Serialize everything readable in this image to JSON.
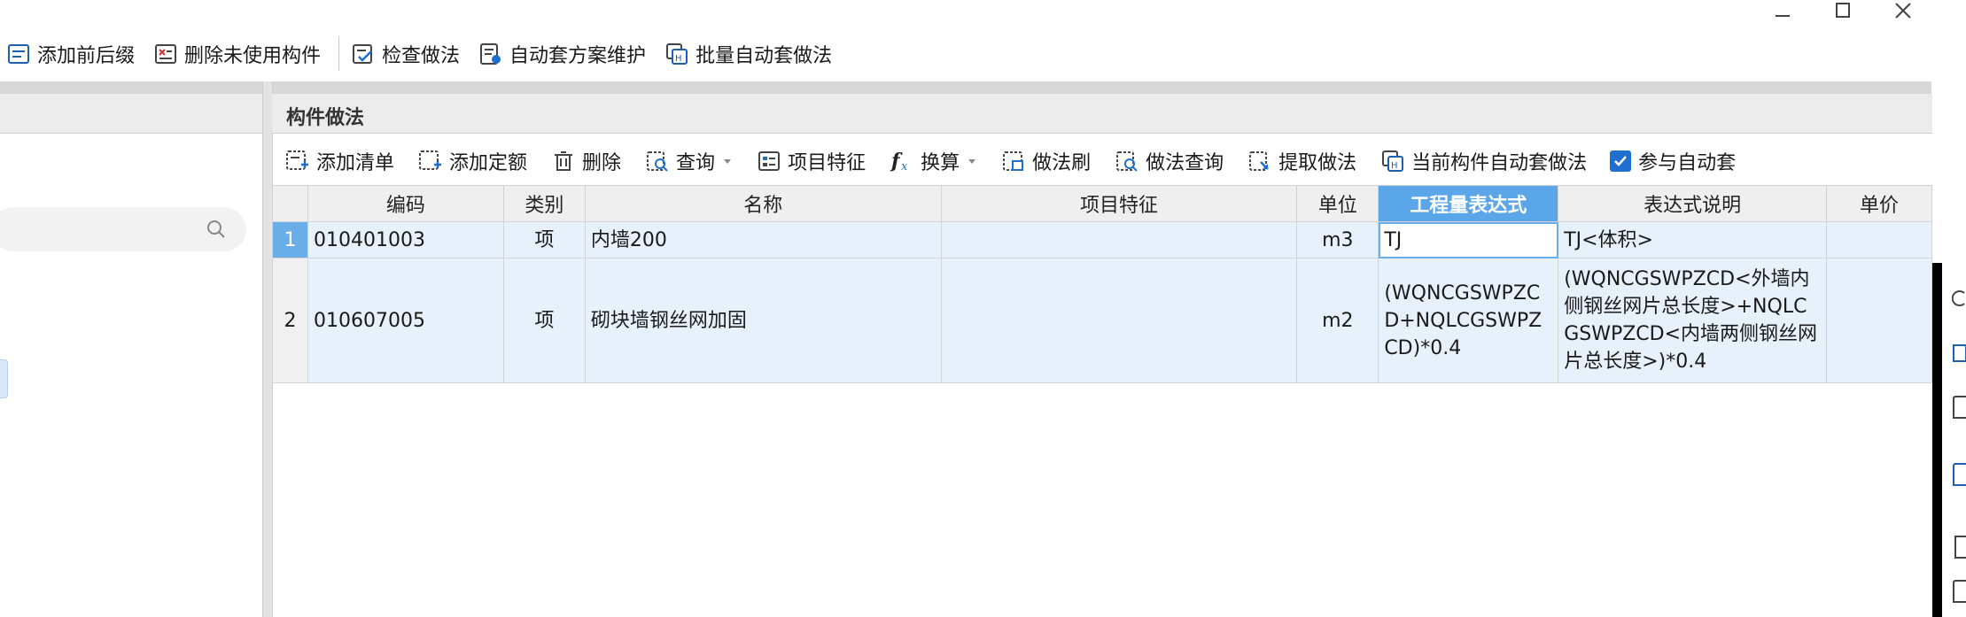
{
  "window": {
    "minimize_icon": "minimize-icon",
    "maximize_icon": "maximize-icon",
    "close_icon": "close-icon"
  },
  "toolbar_top": {
    "items": [
      {
        "label": "添加前后缀",
        "icon": "add-prefix-icon"
      },
      {
        "label": "删除未使用构件",
        "icon": "delete-unused-icon"
      },
      {
        "label": "检查做法",
        "icon": "check-method-icon"
      },
      {
        "label": "自动套方案维护",
        "icon": "auto-scheme-icon"
      },
      {
        "label": "批量自动套做法",
        "icon": "batch-auto-icon"
      }
    ]
  },
  "panel": {
    "title": "构件做法"
  },
  "toolbar2": {
    "items": [
      {
        "label": "添加清单",
        "icon": "add-list-icon"
      },
      {
        "label": "添加定额",
        "icon": "add-quota-icon"
      },
      {
        "label": "删除",
        "icon": "trash-icon"
      },
      {
        "label": "查询",
        "icon": "query-icon"
      },
      {
        "label": "项目特征",
        "icon": "feature-icon"
      },
      {
        "label": "换算",
        "icon": "fx-icon"
      },
      {
        "label": "做法刷",
        "icon": "brush-icon"
      },
      {
        "label": "做法查询",
        "icon": "method-query-icon"
      },
      {
        "label": "提取做法",
        "icon": "extract-icon"
      },
      {
        "label": "当前构件自动套做法",
        "icon": "current-auto-icon"
      }
    ],
    "checkbox_label": "参与自动套",
    "checkbox_checked": true
  },
  "table": {
    "columns": [
      "编码",
      "类别",
      "名称",
      "项目特征",
      "单位",
      "工程量表达式",
      "表达式说明",
      "单价"
    ],
    "rows": [
      {
        "num": "1",
        "code": "010401003",
        "type": "项",
        "name": "内墙200",
        "feature": "",
        "unit": "m3",
        "expr": "TJ",
        "desc": "TJ<体积>",
        "price": ""
      },
      {
        "num": "2",
        "code": "010607005",
        "type": "项",
        "name": "砌块墙钢丝网加固",
        "feature": "",
        "unit": "m2",
        "expr": "(WQNCGSWPZCD+NQLCGSWPZCD)*0.4",
        "desc": "(WQNCGSWPZCD<外墙内侧钢丝网片总长度>+NQLCGSWPZCD<内墙两侧钢丝网片总长度>)*0.4",
        "price": ""
      }
    ]
  },
  "colors": {
    "active_header": "#5aa6e8",
    "row_fill": "#e6f1fc",
    "accent": "#1f6fd1"
  }
}
